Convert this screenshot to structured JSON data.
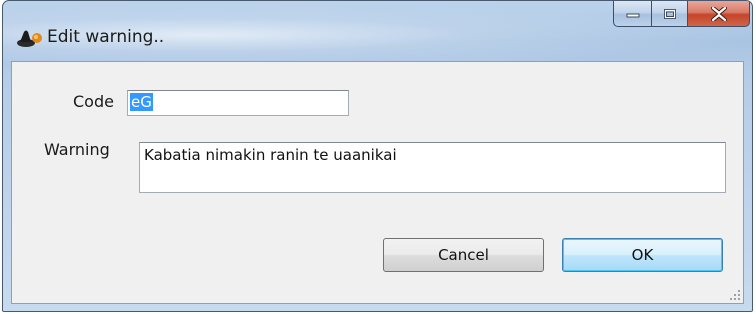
{
  "window": {
    "title": "Edit warning..",
    "app_icon": "app-icon",
    "buttons": {
      "minimize_icon": "minimize-icon",
      "maximize_icon": "maximize-icon",
      "close_icon": "close-icon"
    }
  },
  "form": {
    "code_label": "Code",
    "code_value": "eG",
    "warning_label": "Warning",
    "warning_value": "Kabatia nimakin ranin te uaanikai"
  },
  "actions": {
    "cancel_label": "Cancel",
    "ok_label": "OK"
  }
}
